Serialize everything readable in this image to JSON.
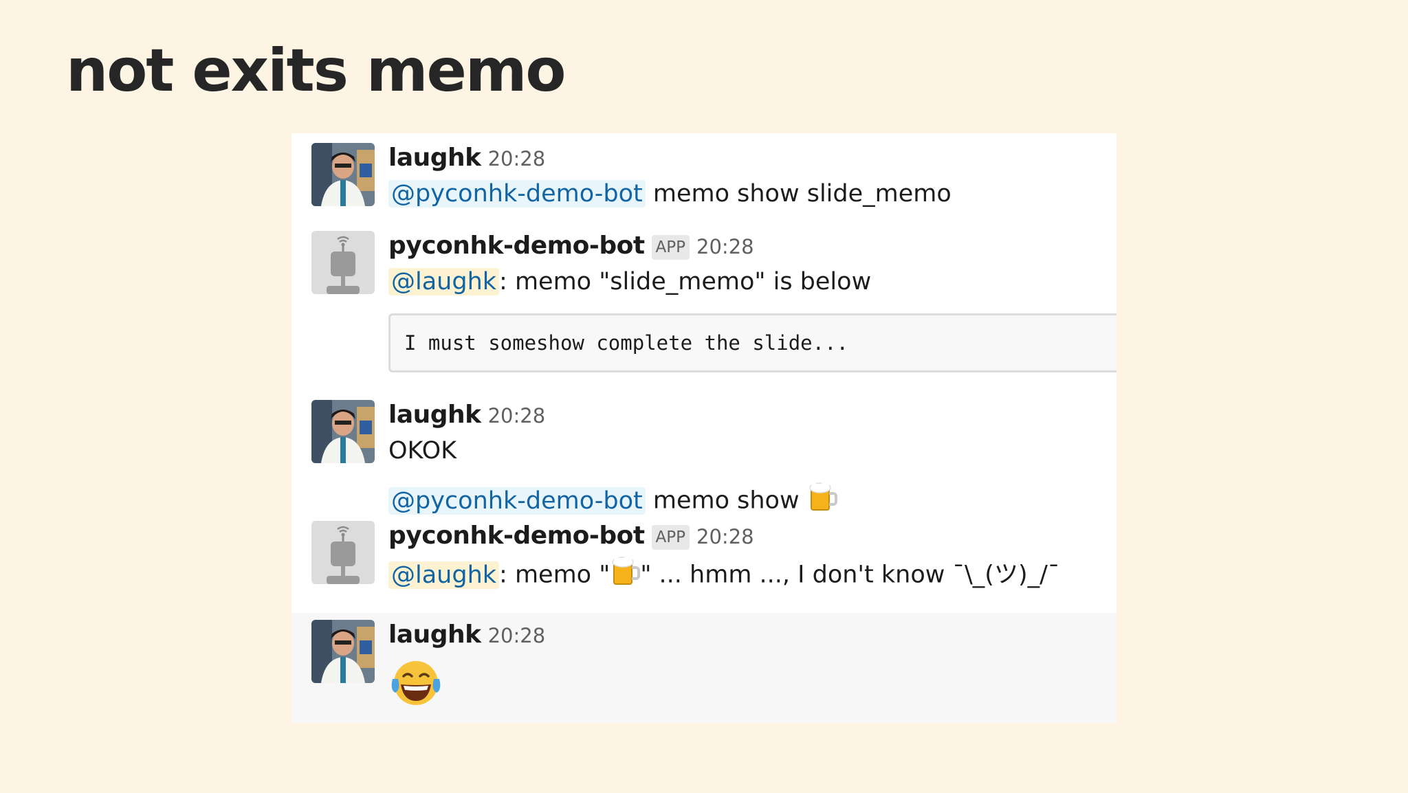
{
  "slide": {
    "title": "not exits memo"
  },
  "messages": [
    {
      "user": "laughk",
      "time": "20:28",
      "mention": "@pyconhk-demo-bot",
      "text": " memo show slide_memo"
    },
    {
      "user": "pyconhk-demo-bot",
      "badge": "APP",
      "time": "20:28",
      "mention": "@laughk",
      "text": ": memo \"slide_memo\" is below",
      "code": "I must someshow complete the slide..."
    },
    {
      "user": "laughk",
      "time": "20:28",
      "text": "OKOK",
      "mention2": "@pyconhk-demo-bot",
      "text2": " memo show ",
      "emoji": "beer-mug-icon"
    },
    {
      "user": "pyconhk-demo-bot",
      "badge": "APP",
      "time": "20:28",
      "mention": "@laughk",
      "text_before": ": memo \"",
      "emoji": "beer-mug-icon",
      "text_after": "\" ... hmm ..., I don't know ¯\\_(ツ)_/¯"
    },
    {
      "user": "laughk",
      "time": "20:28",
      "emoji": "face-with-tears-of-joy-icon"
    }
  ],
  "colors": {
    "background": "#fdf4e3",
    "mention_text": "#1264a3",
    "bot_mention_bg": "#e8f5fa",
    "user_mention_bg": "#fdf3d2"
  }
}
